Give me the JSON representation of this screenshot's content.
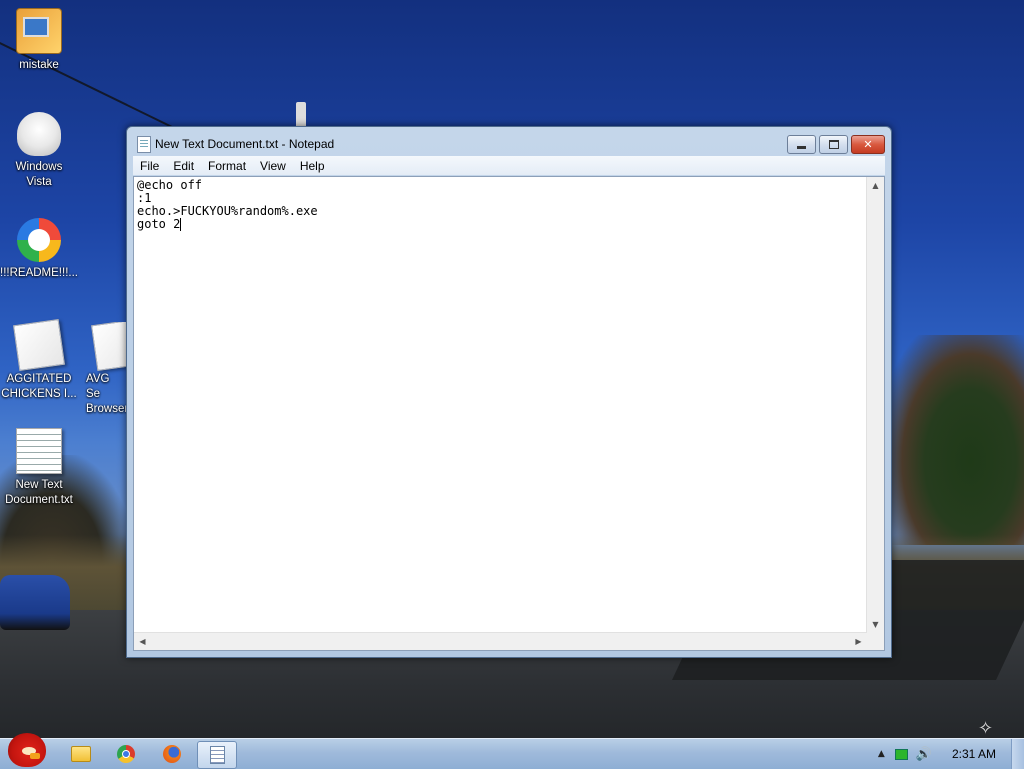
{
  "desktop": {
    "icons": [
      {
        "label": "mistake",
        "icon": "computer-icon"
      },
      {
        "label": "Windows\nVista",
        "icon": "vista-icon"
      },
      {
        "label": "!!!README!!!...",
        "icon": "browser-icon"
      },
      {
        "label": "AGGITATED\nCHICKENS I...",
        "icon": "file-icon"
      },
      {
        "label": "AVG Se\nBrowser",
        "icon": "file-icon"
      },
      {
        "label": "New Text\nDocument.txt",
        "icon": "text-document-icon"
      }
    ]
  },
  "notepad": {
    "title": "New Text Document.txt - Notepad",
    "menu": [
      "File",
      "Edit",
      "Format",
      "View",
      "Help"
    ],
    "lines": [
      "@echo off",
      ":1",
      "echo.>FUCKYOU%random%.exe",
      "goto 2"
    ],
    "buttons": {
      "minimize": "minimize",
      "maximize": "maximize",
      "close": "✕"
    }
  },
  "taskbar": {
    "pinned": [
      "folder-icon",
      "chrome-icon",
      "firefox-icon",
      "notepad-icon"
    ],
    "active_app": "notepad-icon",
    "clock": "2:31 AM",
    "tray": {
      "show_hidden": "▲",
      "volume": "🔊"
    }
  }
}
